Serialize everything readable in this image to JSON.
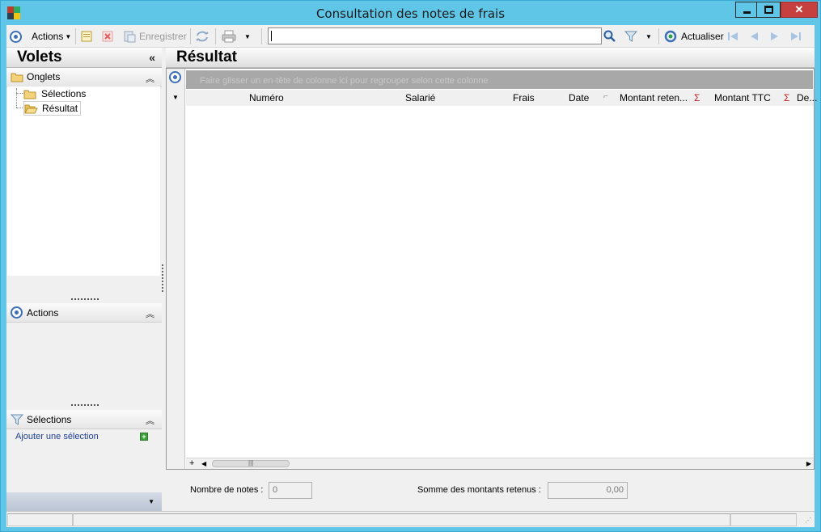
{
  "window": {
    "title": "Consultation des notes de frais",
    "close_glyph": "✕"
  },
  "toolbar": {
    "actions_label": "Actions",
    "save_label": "Enregistrer",
    "refresh_label": "Actualiser",
    "search_value": ""
  },
  "left": {
    "volets_title": "Volets",
    "onglets_label": "Onglets",
    "tree": [
      "Sélections",
      "Résultat"
    ],
    "actions_label": "Actions",
    "selections_label": "Sélections",
    "add_selection_label": "Ajouter une sélection"
  },
  "result": {
    "title": "Résultat",
    "group_hint": "Faire glisser un en-tête de colonne ici pour regrouper selon cette colonne",
    "columns": [
      "Numéro",
      "Salarié",
      "Frais",
      "Date",
      "Montant reten...",
      "Montant TTC",
      "De..."
    ],
    "plus_glyph": "+"
  },
  "footer": {
    "count_label": "Nombre de notes :",
    "count_value": "0",
    "sum_label": "Somme des montants retenus :",
    "sum_value": "0,00"
  },
  "colors": {
    "title_bar": "#5fc6e8",
    "close_button": "#c74040",
    "accent_blue": "#3b6fb6",
    "group_band": "#a8a8a8"
  }
}
